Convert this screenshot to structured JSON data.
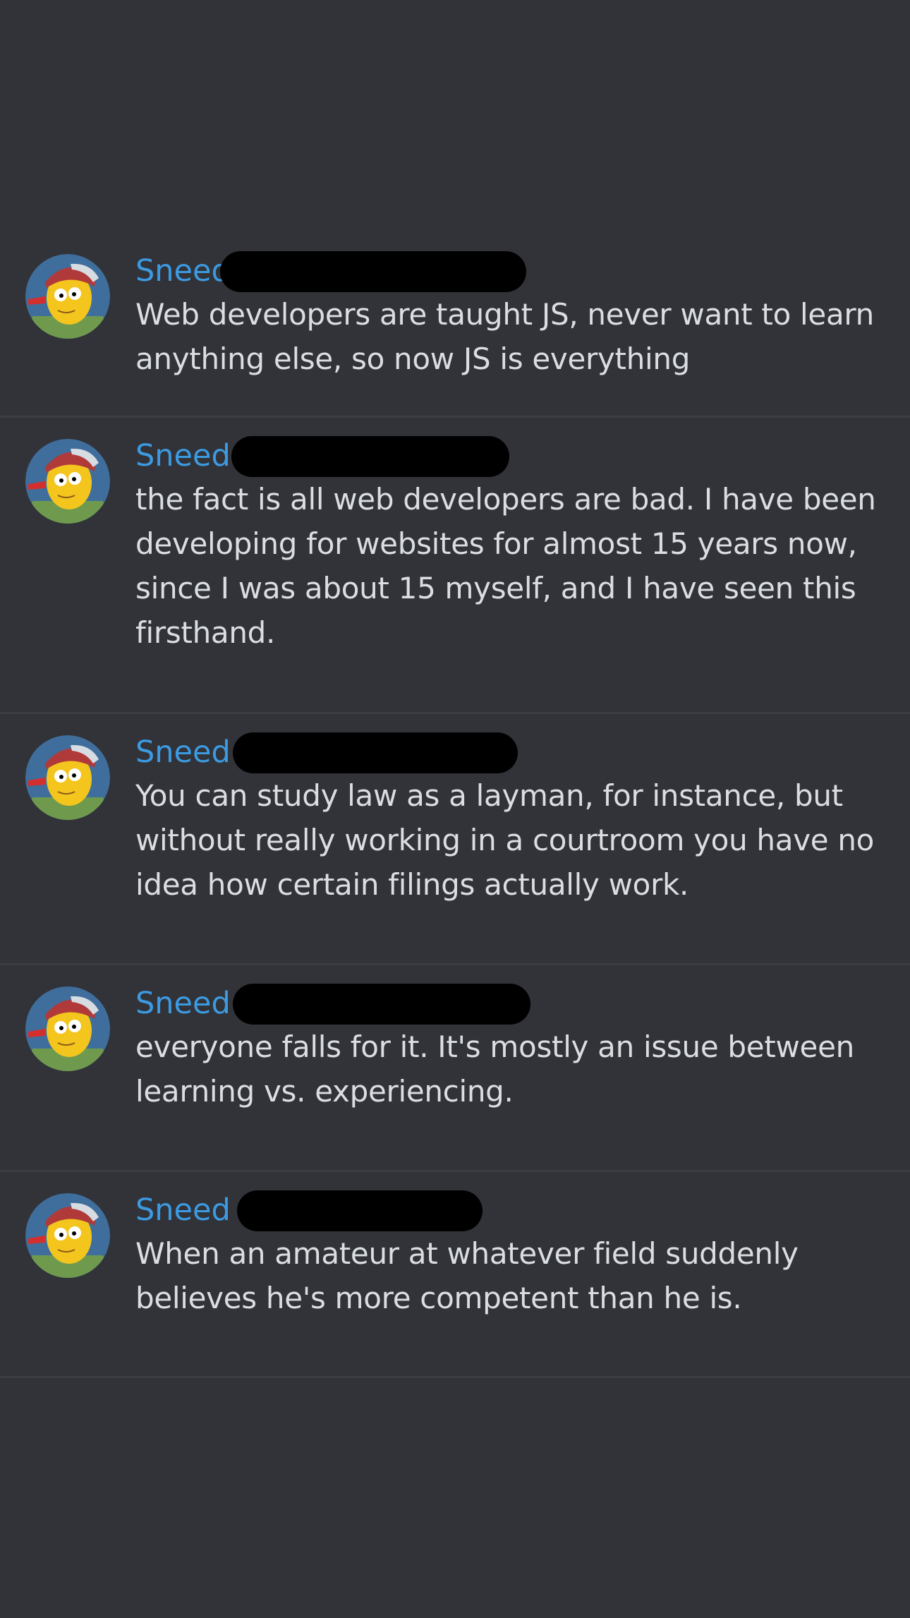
{
  "messages": [
    {
      "username": "Sneed",
      "text": "Web developers are taught JS, never want to learn anything else, so now JS is everything"
    },
    {
      "username": "Sneed",
      "text": "the fact is all web developers are bad. I have been developing for websites for almost 15 years now, since I was about 15 myself, and I have seen this firsthand."
    },
    {
      "username": "Sneed",
      "text": "You can study law as a layman, for instance, but without really working in a courtroom you have no idea how certain filings actually work."
    },
    {
      "username": "Sneed",
      "text": "everyone falls for it. It's mostly an issue between learning vs. experiencing."
    },
    {
      "username": "Sneed",
      "text": "When an amateur at whatever field suddenly believes he's more competent than he is."
    }
  ],
  "avatar_icon": "cartoon-avatar-icon",
  "colors": {
    "background": "#313338",
    "username": "#3c9ae0",
    "text": "#dbdee1",
    "redaction": "#000000"
  }
}
